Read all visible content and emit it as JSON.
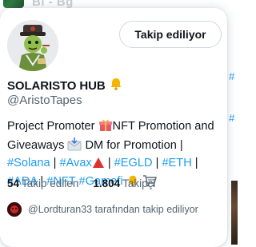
{
  "background": {
    "top_text": "Bl - Bǧ",
    "side_tags": [
      "#",
      "#"
    ]
  },
  "profile": {
    "display_name": "SOLARISTO HUB",
    "handle": "@AristoTapes",
    "follow_button_label": "Takip ediliyor",
    "bio": {
      "line1": {
        "text": "Project Promoter ",
        "text2": "NFT Promotion and"
      },
      "line2": {
        "text": "Giveaways ",
        "text2": " DM for Promotion |"
      },
      "line3": {
        "tag1": "#Solana",
        "sep1": " | ",
        "tag2": "#Avax",
        "sep2": " | ",
        "tag3": "#EGLD",
        "sep3": " | ",
        "tag4": "#ETH",
        "sep4": " |"
      },
      "line4": {
        "tag1": "#ADA",
        "sep1": " | ",
        "tag2": "#NFT",
        "sep2": " ",
        "tag3": "#Gamefi",
        "sep3": " "
      }
    },
    "stats": {
      "following_count": "54",
      "following_label": "Takip edilen",
      "followers_count": "1.804",
      "followers_label": "Takipçi"
    },
    "followed_by": "@Lordturan33 tarafından takip ediliyor"
  },
  "icons": {
    "verified_like": "bell-icon",
    "gift": "gift-icon",
    "envelope": "envelope-icon",
    "warning": "triangle-icon",
    "bell": "bell-icon",
    "cart": "cart-icon"
  },
  "colors": {
    "accent": "#1d9bf0",
    "text": "#0f1419",
    "muted": "#536471",
    "border": "#cfd9de"
  }
}
